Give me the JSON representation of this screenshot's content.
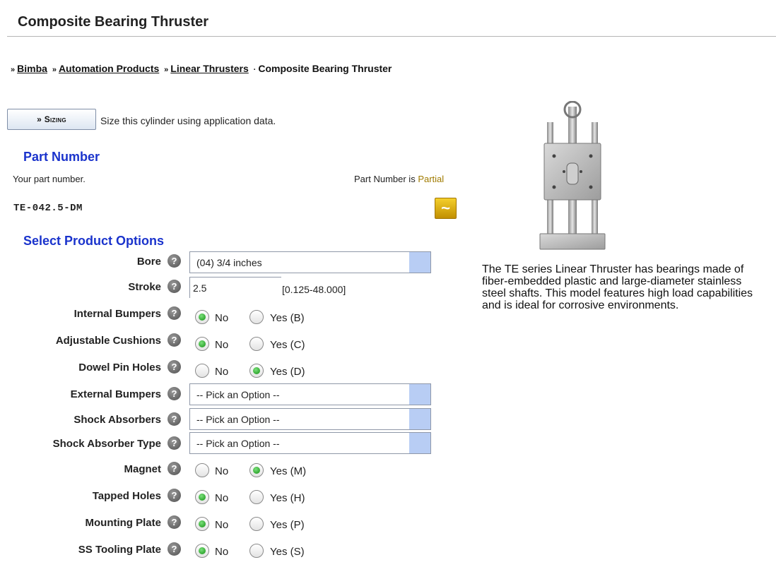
{
  "page": {
    "title": "Composite Bearing Thruster"
  },
  "breadcrumb": {
    "items": [
      "Bimba",
      "Automation Products",
      "Linear Thrusters"
    ],
    "current": "Composite Bearing Thruster"
  },
  "sizing": {
    "button_label": "» Sizing",
    "description": "Size this cylinder using application data."
  },
  "part_number": {
    "heading": "Part Number",
    "description": "Your part number.",
    "status_prefix": "Part Number is ",
    "status_value": "Partial",
    "value": "TE-042.5-DM",
    "status_icon": "tilde-partial-icon"
  },
  "options": {
    "heading": "Select Product Options",
    "help_icon_glyph": "?",
    "bore": {
      "label": "Bore",
      "value": "(04) 3/4 inches"
    },
    "stroke": {
      "label": "Stroke",
      "value": "2.5",
      "range": "[0.125-48.000]"
    },
    "internal_bumpers": {
      "label": "Internal Bumpers",
      "no": "No",
      "yes": "Yes (B)",
      "selected": "no"
    },
    "adjustable_cushions": {
      "label": "Adjustable Cushions",
      "no": "No",
      "yes": "Yes (C)",
      "selected": "no"
    },
    "dowel_pin_holes": {
      "label": "Dowel Pin Holes",
      "no": "No",
      "yes": "Yes (D)",
      "selected": "yes"
    },
    "external_bumpers": {
      "label": "External Bumpers",
      "value": "-- Pick an Option --"
    },
    "shock_absorbers": {
      "label": "Shock Absorbers",
      "value": "-- Pick an Option --"
    },
    "shock_absorber_type": {
      "label": "Shock Absorber Type",
      "value": "-- Pick an Option --"
    },
    "magnet": {
      "label": "Magnet",
      "no": "No",
      "yes": "Yes (M)",
      "selected": "yes"
    },
    "tapped_holes": {
      "label": "Tapped Holes",
      "no": "No",
      "yes": "Yes (H)",
      "selected": "no"
    },
    "mounting_plate": {
      "label": "Mounting Plate",
      "no": "No",
      "yes": "Yes (P)",
      "selected": "no"
    },
    "ss_tooling_plate": {
      "label": "SS Tooling Plate",
      "no": "No",
      "yes": "Yes (S)",
      "selected": "no"
    }
  },
  "product": {
    "description": "The TE series Linear Thruster has bearings made of fiber-embedded plastic and large-diameter stainless steel shafts. This model features high load capabilities and is ideal for corrosive environments."
  }
}
